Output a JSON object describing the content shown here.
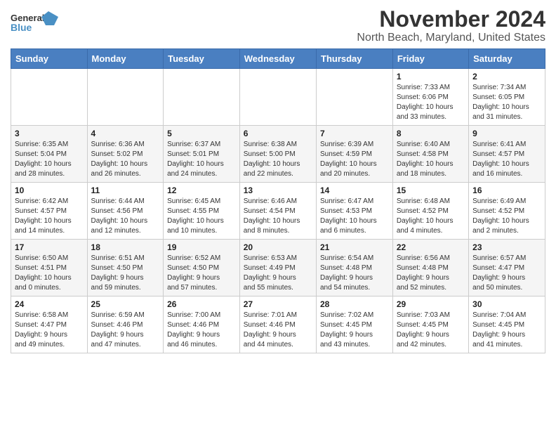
{
  "header": {
    "logo_general": "General",
    "logo_blue": "Blue",
    "title": "November 2024",
    "subtitle": "North Beach, Maryland, United States"
  },
  "calendar": {
    "days_of_week": [
      "Sunday",
      "Monday",
      "Tuesday",
      "Wednesday",
      "Thursday",
      "Friday",
      "Saturday"
    ],
    "weeks": [
      [
        {
          "day": "",
          "info": ""
        },
        {
          "day": "",
          "info": ""
        },
        {
          "day": "",
          "info": ""
        },
        {
          "day": "",
          "info": ""
        },
        {
          "day": "",
          "info": ""
        },
        {
          "day": "1",
          "info": "Sunrise: 7:33 AM\nSunset: 6:06 PM\nDaylight: 10 hours\nand 33 minutes."
        },
        {
          "day": "2",
          "info": "Sunrise: 7:34 AM\nSunset: 6:05 PM\nDaylight: 10 hours\nand 31 minutes."
        }
      ],
      [
        {
          "day": "3",
          "info": "Sunrise: 6:35 AM\nSunset: 5:04 PM\nDaylight: 10 hours\nand 28 minutes."
        },
        {
          "day": "4",
          "info": "Sunrise: 6:36 AM\nSunset: 5:02 PM\nDaylight: 10 hours\nand 26 minutes."
        },
        {
          "day": "5",
          "info": "Sunrise: 6:37 AM\nSunset: 5:01 PM\nDaylight: 10 hours\nand 24 minutes."
        },
        {
          "day": "6",
          "info": "Sunrise: 6:38 AM\nSunset: 5:00 PM\nDaylight: 10 hours\nand 22 minutes."
        },
        {
          "day": "7",
          "info": "Sunrise: 6:39 AM\nSunset: 4:59 PM\nDaylight: 10 hours\nand 20 minutes."
        },
        {
          "day": "8",
          "info": "Sunrise: 6:40 AM\nSunset: 4:58 PM\nDaylight: 10 hours\nand 18 minutes."
        },
        {
          "day": "9",
          "info": "Sunrise: 6:41 AM\nSunset: 4:57 PM\nDaylight: 10 hours\nand 16 minutes."
        }
      ],
      [
        {
          "day": "10",
          "info": "Sunrise: 6:42 AM\nSunset: 4:57 PM\nDaylight: 10 hours\nand 14 minutes."
        },
        {
          "day": "11",
          "info": "Sunrise: 6:44 AM\nSunset: 4:56 PM\nDaylight: 10 hours\nand 12 minutes."
        },
        {
          "day": "12",
          "info": "Sunrise: 6:45 AM\nSunset: 4:55 PM\nDaylight: 10 hours\nand 10 minutes."
        },
        {
          "day": "13",
          "info": "Sunrise: 6:46 AM\nSunset: 4:54 PM\nDaylight: 10 hours\nand 8 minutes."
        },
        {
          "day": "14",
          "info": "Sunrise: 6:47 AM\nSunset: 4:53 PM\nDaylight: 10 hours\nand 6 minutes."
        },
        {
          "day": "15",
          "info": "Sunrise: 6:48 AM\nSunset: 4:52 PM\nDaylight: 10 hours\nand 4 minutes."
        },
        {
          "day": "16",
          "info": "Sunrise: 6:49 AM\nSunset: 4:52 PM\nDaylight: 10 hours\nand 2 minutes."
        }
      ],
      [
        {
          "day": "17",
          "info": "Sunrise: 6:50 AM\nSunset: 4:51 PM\nDaylight: 10 hours\nand 0 minutes."
        },
        {
          "day": "18",
          "info": "Sunrise: 6:51 AM\nSunset: 4:50 PM\nDaylight: 9 hours\nand 59 minutes."
        },
        {
          "day": "19",
          "info": "Sunrise: 6:52 AM\nSunset: 4:50 PM\nDaylight: 9 hours\nand 57 minutes."
        },
        {
          "day": "20",
          "info": "Sunrise: 6:53 AM\nSunset: 4:49 PM\nDaylight: 9 hours\nand 55 minutes."
        },
        {
          "day": "21",
          "info": "Sunrise: 6:54 AM\nSunset: 4:48 PM\nDaylight: 9 hours\nand 54 minutes."
        },
        {
          "day": "22",
          "info": "Sunrise: 6:56 AM\nSunset: 4:48 PM\nDaylight: 9 hours\nand 52 minutes."
        },
        {
          "day": "23",
          "info": "Sunrise: 6:57 AM\nSunset: 4:47 PM\nDaylight: 9 hours\nand 50 minutes."
        }
      ],
      [
        {
          "day": "24",
          "info": "Sunrise: 6:58 AM\nSunset: 4:47 PM\nDaylight: 9 hours\nand 49 minutes."
        },
        {
          "day": "25",
          "info": "Sunrise: 6:59 AM\nSunset: 4:46 PM\nDaylight: 9 hours\nand 47 minutes."
        },
        {
          "day": "26",
          "info": "Sunrise: 7:00 AM\nSunset: 4:46 PM\nDaylight: 9 hours\nand 46 minutes."
        },
        {
          "day": "27",
          "info": "Sunrise: 7:01 AM\nSunset: 4:46 PM\nDaylight: 9 hours\nand 44 minutes."
        },
        {
          "day": "28",
          "info": "Sunrise: 7:02 AM\nSunset: 4:45 PM\nDaylight: 9 hours\nand 43 minutes."
        },
        {
          "day": "29",
          "info": "Sunrise: 7:03 AM\nSunset: 4:45 PM\nDaylight: 9 hours\nand 42 minutes."
        },
        {
          "day": "30",
          "info": "Sunrise: 7:04 AM\nSunset: 4:45 PM\nDaylight: 9 hours\nand 41 minutes."
        }
      ]
    ]
  }
}
